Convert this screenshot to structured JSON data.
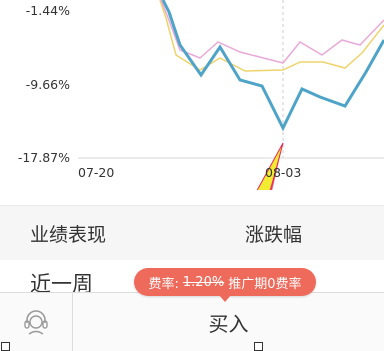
{
  "chart": {
    "y_labels": [
      "-1.44%",
      "-9.66%",
      "-17.87%"
    ],
    "x_labels": [
      "07-20",
      "08-03"
    ],
    "colors": {
      "main": "#4ea3c8",
      "pink": "#e9a9d8",
      "yellow": "#eed36a",
      "arrow_red": "#e8275a",
      "arrow_yellow": "#f3ea32"
    }
  },
  "performance": {
    "label": "业绩表现",
    "column": "涨跌幅",
    "first_row": "近一周"
  },
  "promo": {
    "prefix": "费率:",
    "old_rate": "1.20%",
    "suffix": "推广期0费率"
  },
  "bottom": {
    "service_icon": "customer-service-icon",
    "buy_label": "买入"
  }
}
